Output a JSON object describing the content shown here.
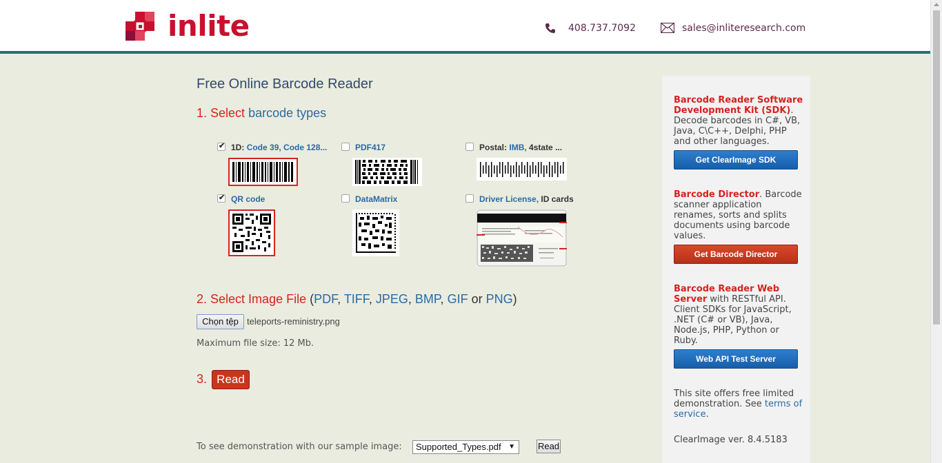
{
  "header": {
    "logo_text": "inlite",
    "phone": "408.737.7092",
    "email": "sales@inliteresearch.com"
  },
  "main": {
    "title": "Free Online Barcode Reader",
    "step1": {
      "num": "1.",
      "word": "Select",
      "rest": "barcode types"
    },
    "barcode_types": [
      {
        "prefix": "1D:",
        "link": "Code 39, Code 128...",
        "suffix": "",
        "checked": true
      },
      {
        "prefix": "",
        "link": "PDF417",
        "suffix": "",
        "checked": false
      },
      {
        "prefix": "Postal:",
        "link": "IMB,",
        "suffix": "4state ...",
        "checked": false
      },
      {
        "prefix": "",
        "link": "QR code",
        "suffix": "",
        "checked": true
      },
      {
        "prefix": "",
        "link": "DataMatrix",
        "suffix": "",
        "checked": false
      },
      {
        "prefix": "",
        "link": "Driver License,",
        "suffix": "ID cards",
        "checked": false
      }
    ],
    "step2": {
      "num": "2.",
      "word": "Select Image File",
      "open": "(",
      "formats": [
        "PDF",
        "TIFF",
        "JPEG",
        "BMP",
        "GIF"
      ],
      "or": "or",
      "last": "PNG",
      "close": ")"
    },
    "file_button": "Chọn tệp",
    "file_name": "teleports-reministry.png",
    "max_size": "Maximum file size: 12 Mb.",
    "step3": {
      "num": "3.",
      "button": "Read"
    },
    "sample": {
      "text": "To see demonstration with our sample image:",
      "selected": "Supported_Types.pdf",
      "button": "Read"
    }
  },
  "sidebar": {
    "sdk": {
      "title": "Barcode Reader Software Development Kit (SDK)",
      "text": ". Decode barcodes in C#, VB, Java, C\\C++, Delphi, PHP and other languages.",
      "button": "Get ClearImage SDK"
    },
    "director": {
      "title": "Barcode Director",
      "text": ". Barcode scanner application renames, sorts and splits documents using barcode values.",
      "button": "Get Barcode Director"
    },
    "web": {
      "title": "Barcode Reader Web Server",
      "text": " with RESTful API. Client SDKs for JavaScript, .NET (C# or VB), Java, Node.js, PHP, Python or Ruby.",
      "button": "Web API Test Server"
    },
    "note": {
      "text": "This site offers free limited demonstration. See ",
      "link": "terms of service",
      "end": "."
    },
    "version": "ClearImage ver. 8.4.5183"
  },
  "colors": {
    "accent_red": "#d6231e",
    "link_blue": "#2a6aa5",
    "header_rule": "#1f7470",
    "background": "#eaecdf"
  }
}
